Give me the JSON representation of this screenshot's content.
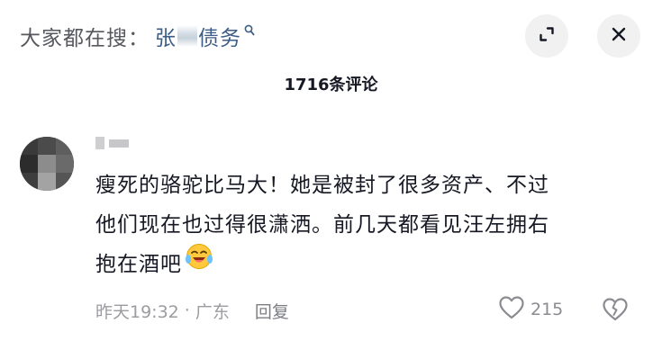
{
  "search_hint": {
    "prefix": "大家都在搜：",
    "keyword_part1": "张",
    "keyword_part2": "债务"
  },
  "header": {
    "comment_count": "1716条评论"
  },
  "comment": {
    "lines": [
      "瘦死的骆驼比马大！她是被封了很多资产、不过",
      "他们现在也过得很潇洒。前几天都看见汪左拥右",
      "抱在酒吧"
    ],
    "emoji": "laughing-crying-emoji",
    "time": "昨天19:32",
    "separator": "·",
    "location": "广东",
    "reply_label": "回复",
    "like_count": "215"
  },
  "icons": {
    "search": "search-icon",
    "expand": "expand-icon",
    "close": "close-icon",
    "heart": "heart-icon",
    "broken_heart": "broken-heart-icon"
  },
  "colors": {
    "keyword": "#3b5d86",
    "muted": "#9b9ca1",
    "text": "#161823",
    "button_bg": "#f1f1f2"
  }
}
